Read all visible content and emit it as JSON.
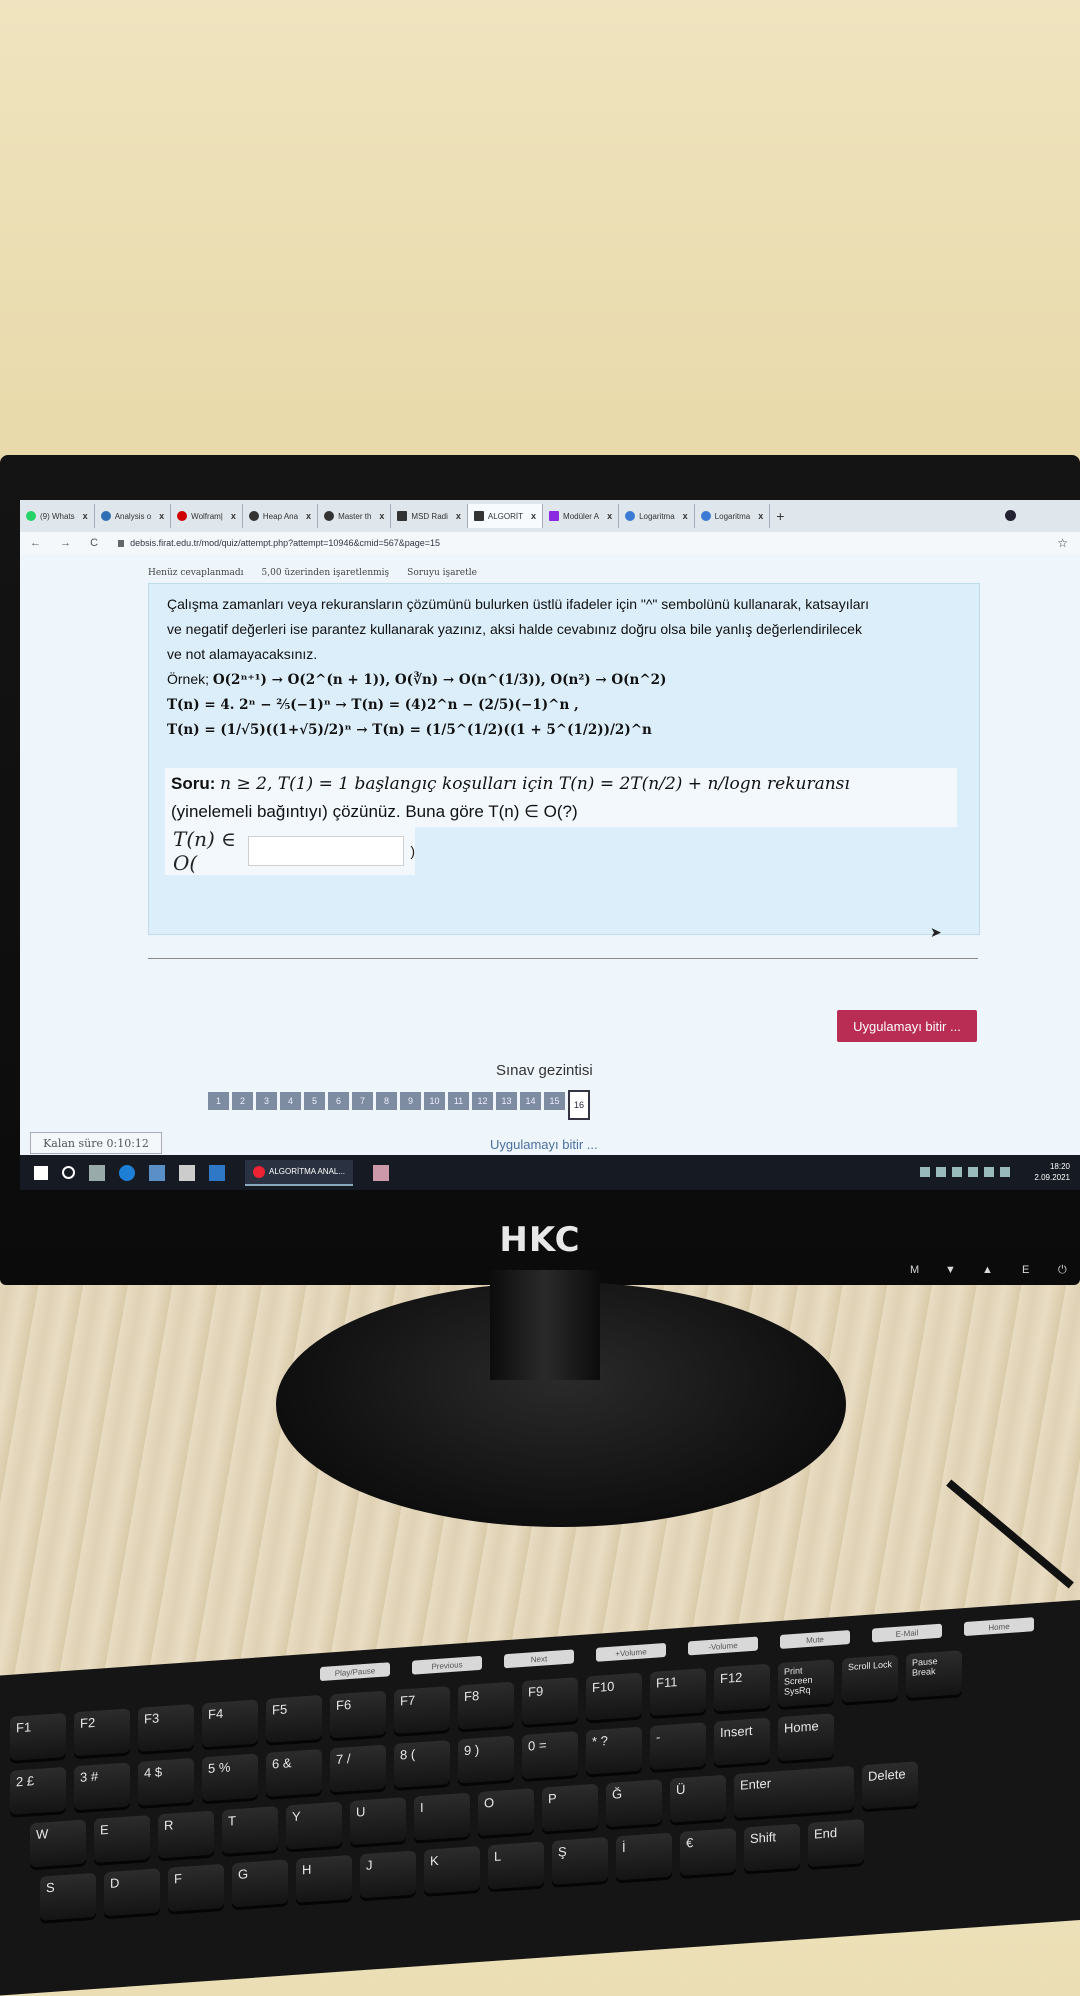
{
  "browser": {
    "tabs": [
      {
        "label": "(9) Whats",
        "color": "#25d366"
      },
      {
        "label": "Analysis o",
        "color": "#2f6fb3"
      },
      {
        "label": "Wolfram|",
        "color": "#d10000"
      },
      {
        "label": "Heap Ana",
        "color": "#333333"
      },
      {
        "label": "Master th",
        "color": "#333333"
      },
      {
        "label": "MSD Radi",
        "color": "#333333"
      },
      {
        "label": "ALGORİT",
        "color": "#333333"
      },
      {
        "label": "Modüler A",
        "color": "#8a2be2"
      },
      {
        "label": "Logaritma",
        "color": "#3b7bd6"
      },
      {
        "label": "Logaritma",
        "color": "#3b7bd6"
      }
    ],
    "close_glyph": "x",
    "new_tab": "+",
    "url": "debsis.firat.edu.tr/mod/quiz/attempt.php?attempt=10946&cmid=567&page=15",
    "nav": "← → C",
    "star": "☆"
  },
  "question": {
    "status": "Henüz cevaplanmadı",
    "points": "5,00 üzerinden işaretlenmiş",
    "flag": "Soruyu işaretle",
    "instructions": [
      "Çalışma zamanları veya rekuransların çözümünü bulurken üstlü ifadeler için \"^\" sembolünü kullanarak, katsayıları",
      "ve negatif değerleri ise parantez kullanarak yazınız, aksi halde cevabınız doğru olsa bile yanlış değerlendirilecek",
      "ve not alamayacaksınız."
    ],
    "example_prefix": "Örnek;",
    "examples": [
      "O(2ⁿ⁺¹) → O(2^(n + 1)),  O(∛n) → O(n^(1/3)), O(n²) → O(n^2)",
      "T(n) = 4. 2ⁿ − ⅖(−1)ⁿ → T(n) = (4)2^n − (2/5)(−1)^n ,",
      "T(n) = (1/√5)((1+√5)/2)ⁿ → T(n) = (1/5^(1/2)((1 + 5^(1/2))/2)^n"
    ],
    "soru_label": "Soru:",
    "soru_line1": "n ≥ 2, T(1) = 1 başlangıç koşulları için T(n) = 2T(n/2) + n/logn rekuransı",
    "soru_line2": "(yinelemeli bağıntıyı) çözünüz.  Buna göre  T(n) ∈ O(?)",
    "answer_label": "T(n) ∈ O(",
    "answer_value": "",
    "answer_close": ")"
  },
  "quiz_nav": {
    "finish_button": "Uygulamayı bitir ...",
    "title": "Sınav gezintisi",
    "pages": [
      "1",
      "2",
      "3",
      "4",
      "5",
      "6",
      "7",
      "8",
      "9",
      "10",
      "11",
      "12",
      "13",
      "14",
      "15",
      "16"
    ],
    "current_page": "16",
    "finish_link": "Uygulamayı bitir ...",
    "timer": "Kalan süre 0:10:12"
  },
  "taskbar": {
    "app_label": "ALGORİTMA ANAL...",
    "time": "18:20",
    "date": "2.09.2021"
  },
  "monitor": {
    "brand": "HKC",
    "osd": [
      "M",
      "▼",
      "▲",
      "E",
      "⏻"
    ]
  },
  "keyboard": {
    "media_keys": [
      "Play/Pause",
      "Previous",
      "Next",
      "+Volume",
      "-Volume",
      "Mute",
      "E-Mail",
      "Home"
    ],
    "fkeys": [
      "F1",
      "F2",
      "F3",
      "F4",
      "F5",
      "F6",
      "F7",
      "F8",
      "F9",
      "F10",
      "F11",
      "F12"
    ],
    "extra_keys": [
      "Print Screen SysRq",
      "Scroll Lock",
      "Pause Break",
      "Insert",
      "Home",
      "Delete",
      "End"
    ],
    "number_keys": [
      "2 £",
      "3 #",
      "4 $",
      "5 %",
      "6 &",
      "7 /",
      "8 (",
      "9 )",
      "0 =",
      "* ?",
      "-"
    ],
    "letter_keys": [
      "W",
      "E",
      "R",
      "T",
      "Y",
      "U",
      "I",
      "O",
      "P",
      "Ğ",
      "Ü"
    ],
    "home_keys": [
      "S",
      "D",
      "F",
      "G",
      "H",
      "J",
      "K",
      "L",
      "Ş",
      "İ"
    ],
    "enter_key": "Enter",
    "euro": "€",
    "shift_key": "Shift"
  }
}
